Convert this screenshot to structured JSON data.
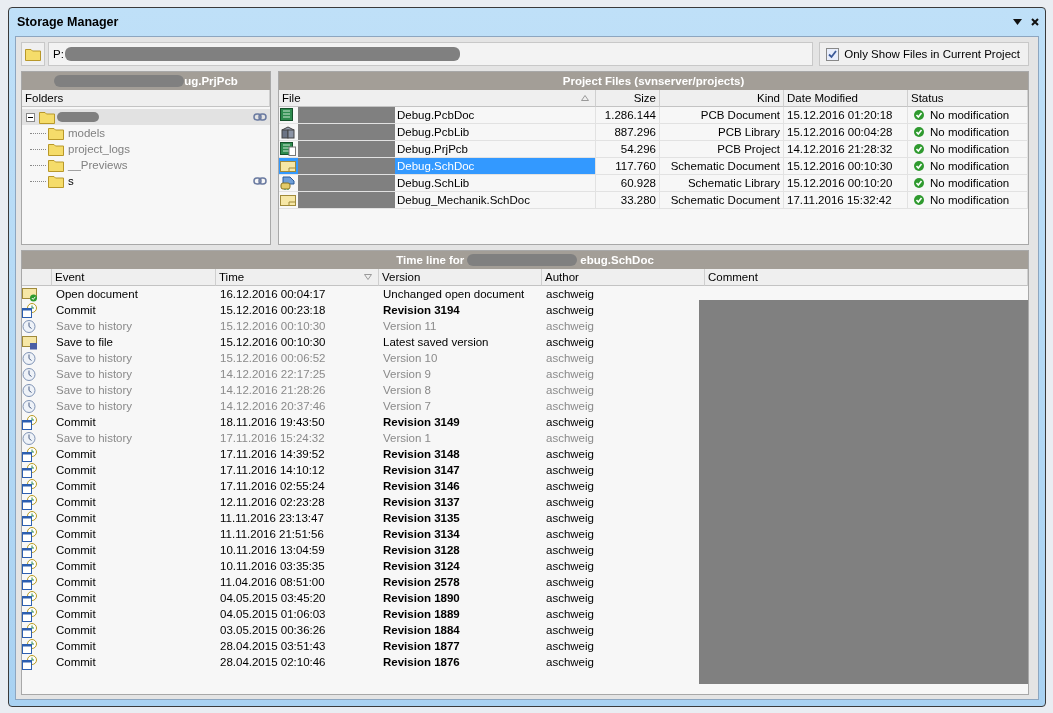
{
  "window": {
    "title": "Storage Manager"
  },
  "path": {
    "value": "P:"
  },
  "only_current_project": {
    "label": "Only Show Files in Current Project",
    "checked": true
  },
  "project_panel": {
    "title": "ug.PrjPcb",
    "column": "Folders",
    "root": {
      "expanded": true,
      "linked": true,
      "selected": true,
      "children": [
        {
          "name": "models",
          "linked": false,
          "selected": false
        },
        {
          "name": "project_logs",
          "linked": false,
          "selected": false
        },
        {
          "name": "__Previews",
          "linked": false,
          "selected": false
        },
        {
          "name": "s",
          "linked": true,
          "selected": false
        }
      ]
    }
  },
  "files_panel": {
    "title": "Project Files (svnserver/projects)",
    "columns": [
      "File",
      "Size",
      "Kind",
      "Date Modified",
      "Status"
    ],
    "rows": [
      {
        "kind": "pcb-doc",
        "name": "Debug.PcbDoc",
        "size": "1.286.144",
        "type": "PCB Document",
        "date": "15.12.2016 01:20:18",
        "status": "No modification",
        "selected": false
      },
      {
        "kind": "pcb-lib",
        "name": "Debug.PcbLib",
        "size": "887.296",
        "type": "PCB Library",
        "date": "15.12.2016 00:04:28",
        "status": "No modification",
        "selected": false
      },
      {
        "kind": "pcb-project",
        "name": "Debug.PrjPcb",
        "size": "54.296",
        "type": "PCB Project",
        "date": "14.12.2016 21:28:32",
        "status": "No modification",
        "selected": false
      },
      {
        "kind": "schematic",
        "name": "Debug.SchDoc",
        "size": "117.760",
        "type": "Schematic Document",
        "date": "15.12.2016 00:10:30",
        "status": "No modification",
        "selected": true
      },
      {
        "kind": "sch-lib",
        "name": "Debug.SchLib",
        "size": "60.928",
        "type": "Schematic Library",
        "date": "15.12.2016 00:10:20",
        "status": "No modification",
        "selected": false
      },
      {
        "kind": "schematic",
        "name": "Debug_Mechanik.SchDoc",
        "size": "33.280",
        "type": "Schematic Document",
        "date": "17.11.2016 15:32:42",
        "status": "No modification",
        "selected": false
      }
    ]
  },
  "timeline": {
    "title": "Time line for",
    "title_tail": "ebug.SchDoc",
    "columns": [
      "Event",
      "Time",
      "Version",
      "Author",
      "Comment"
    ],
    "rows": [
      {
        "kind": "open",
        "event": "Open document",
        "time": "16.12.2016 00:04:17",
        "version": "Unchanged open document",
        "author": "aschweig"
      },
      {
        "kind": "commit",
        "event": "Commit",
        "time": "15.12.2016 00:23:18",
        "version": "Revision 3194",
        "author": "aschweig"
      },
      {
        "kind": "history",
        "event": "Save to history",
        "time": "15.12.2016 00:10:30",
        "version": "Version 11",
        "author": "aschweig"
      },
      {
        "kind": "save",
        "event": "Save to file",
        "time": "15.12.2016 00:10:30",
        "version": "Latest saved version",
        "author": "aschweig"
      },
      {
        "kind": "history",
        "event": "Save to history",
        "time": "15.12.2016 00:06:52",
        "version": "Version 10",
        "author": "aschweig"
      },
      {
        "kind": "history",
        "event": "Save to history",
        "time": "14.12.2016 22:17:25",
        "version": "Version 9",
        "author": "aschweig"
      },
      {
        "kind": "history",
        "event": "Save to history",
        "time": "14.12.2016 21:28:26",
        "version": "Version 8",
        "author": "aschweig"
      },
      {
        "kind": "history",
        "event": "Save to history",
        "time": "14.12.2016 20:37:46",
        "version": "Version 7",
        "author": "aschweig"
      },
      {
        "kind": "commit",
        "event": "Commit",
        "time": "18.11.2016 19:43:50",
        "version": "Revision 3149",
        "author": "aschweig"
      },
      {
        "kind": "history",
        "event": "Save to history",
        "time": "17.11.2016 15:24:32",
        "version": "Version 1",
        "author": "aschweig"
      },
      {
        "kind": "commit",
        "event": "Commit",
        "time": "17.11.2016 14:39:52",
        "version": "Revision 3148",
        "author": "aschweig"
      },
      {
        "kind": "commit",
        "event": "Commit",
        "time": "17.11.2016 14:10:12",
        "version": "Revision 3147",
        "author": "aschweig"
      },
      {
        "kind": "commit",
        "event": "Commit",
        "time": "17.11.2016 02:55:24",
        "version": "Revision 3146",
        "author": "aschweig"
      },
      {
        "kind": "commit",
        "event": "Commit",
        "time": "12.11.2016 02:23:28",
        "version": "Revision 3137",
        "author": "aschweig"
      },
      {
        "kind": "commit",
        "event": "Commit",
        "time": "11.11.2016 23:13:47",
        "version": "Revision 3135",
        "author": "aschweig"
      },
      {
        "kind": "commit",
        "event": "Commit",
        "time": "11.11.2016 21:51:56",
        "version": "Revision 3134",
        "author": "aschweig"
      },
      {
        "kind": "commit",
        "event": "Commit",
        "time": "10.11.2016 13:04:59",
        "version": "Revision 3128",
        "author": "aschweig"
      },
      {
        "kind": "commit",
        "event": "Commit",
        "time": "10.11.2016 03:35:35",
        "version": "Revision 3124",
        "author": "aschweig"
      },
      {
        "kind": "commit",
        "event": "Commit",
        "time": "11.04.2016 08:51:00",
        "version": "Revision 2578",
        "author": "aschweig"
      },
      {
        "kind": "commit",
        "event": "Commit",
        "time": "04.05.2015 03:45:20",
        "version": "Revision 1890",
        "author": "aschweig"
      },
      {
        "kind": "commit",
        "event": "Commit",
        "time": "04.05.2015 01:06:03",
        "version": "Revision 1889",
        "author": "aschweig"
      },
      {
        "kind": "commit",
        "event": "Commit",
        "time": "03.05.2015 00:36:26",
        "version": "Revision 1884",
        "author": "aschweig"
      },
      {
        "kind": "commit",
        "event": "Commit",
        "time": "28.04.2015 03:51:43",
        "version": "Revision 1877",
        "author": "aschweig"
      },
      {
        "kind": "commit",
        "event": "Commit",
        "time": "28.04.2015 02:10:46",
        "version": "Revision 1876",
        "author": "aschweig"
      }
    ]
  }
}
